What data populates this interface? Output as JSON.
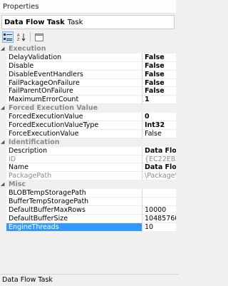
{
  "window": {
    "title": "Properties"
  },
  "object": {
    "name": "Data Flow Task",
    "type": "Task"
  },
  "categories": [
    {
      "name": "Execution",
      "rows": [
        {
          "name": "DelayValidation",
          "value": "False",
          "bold": true
        },
        {
          "name": "Disable",
          "value": "False",
          "bold": true
        },
        {
          "name": "DisableEventHandlers",
          "value": "False",
          "bold": true
        },
        {
          "name": "FailPackageOnFailure",
          "value": "False",
          "bold": true
        },
        {
          "name": "FailParentOnFailure",
          "value": "False",
          "bold": true
        },
        {
          "name": "MaximumErrorCount",
          "value": "1",
          "bold": true
        }
      ]
    },
    {
      "name": "Forced Execution Value",
      "rows": [
        {
          "name": "ForcedExecutionValue",
          "value": "0",
          "bold": true
        },
        {
          "name": "ForcedExecutionValueType",
          "value": "Int32",
          "bold": true
        },
        {
          "name": "ForceExecutionValue",
          "value": "False",
          "bold": false
        }
      ]
    },
    {
      "name": "Identification",
      "rows": [
        {
          "name": "Description",
          "value": "Data Flow",
          "bold": true
        },
        {
          "name": "ID",
          "value": "{EC22EBA",
          "bold": false,
          "readonly": true
        },
        {
          "name": "Name",
          "value": "Data Flow",
          "bold": true
        },
        {
          "name": "PackagePath",
          "value": "\\Package\\",
          "bold": false,
          "readonly": true
        }
      ]
    },
    {
      "name": "Misc",
      "rows": [
        {
          "name": "BLOBTempStoragePath",
          "value": "",
          "bold": false
        },
        {
          "name": "BufferTempStoragePath",
          "value": "",
          "bold": false
        },
        {
          "name": "DefaultBufferMaxRows",
          "value": "10000",
          "bold": false
        },
        {
          "name": "DefaultBufferSize",
          "value": "10485760",
          "bold": false
        },
        {
          "name": "EngineThreads",
          "value": "10",
          "bold": false,
          "selected": true
        }
      ]
    }
  ],
  "description": {
    "text": "Data Flow Task"
  },
  "colors": {
    "selection": "#3399ff",
    "category_bg": "#f0f0f0",
    "category_text": "#8a8a8a"
  }
}
